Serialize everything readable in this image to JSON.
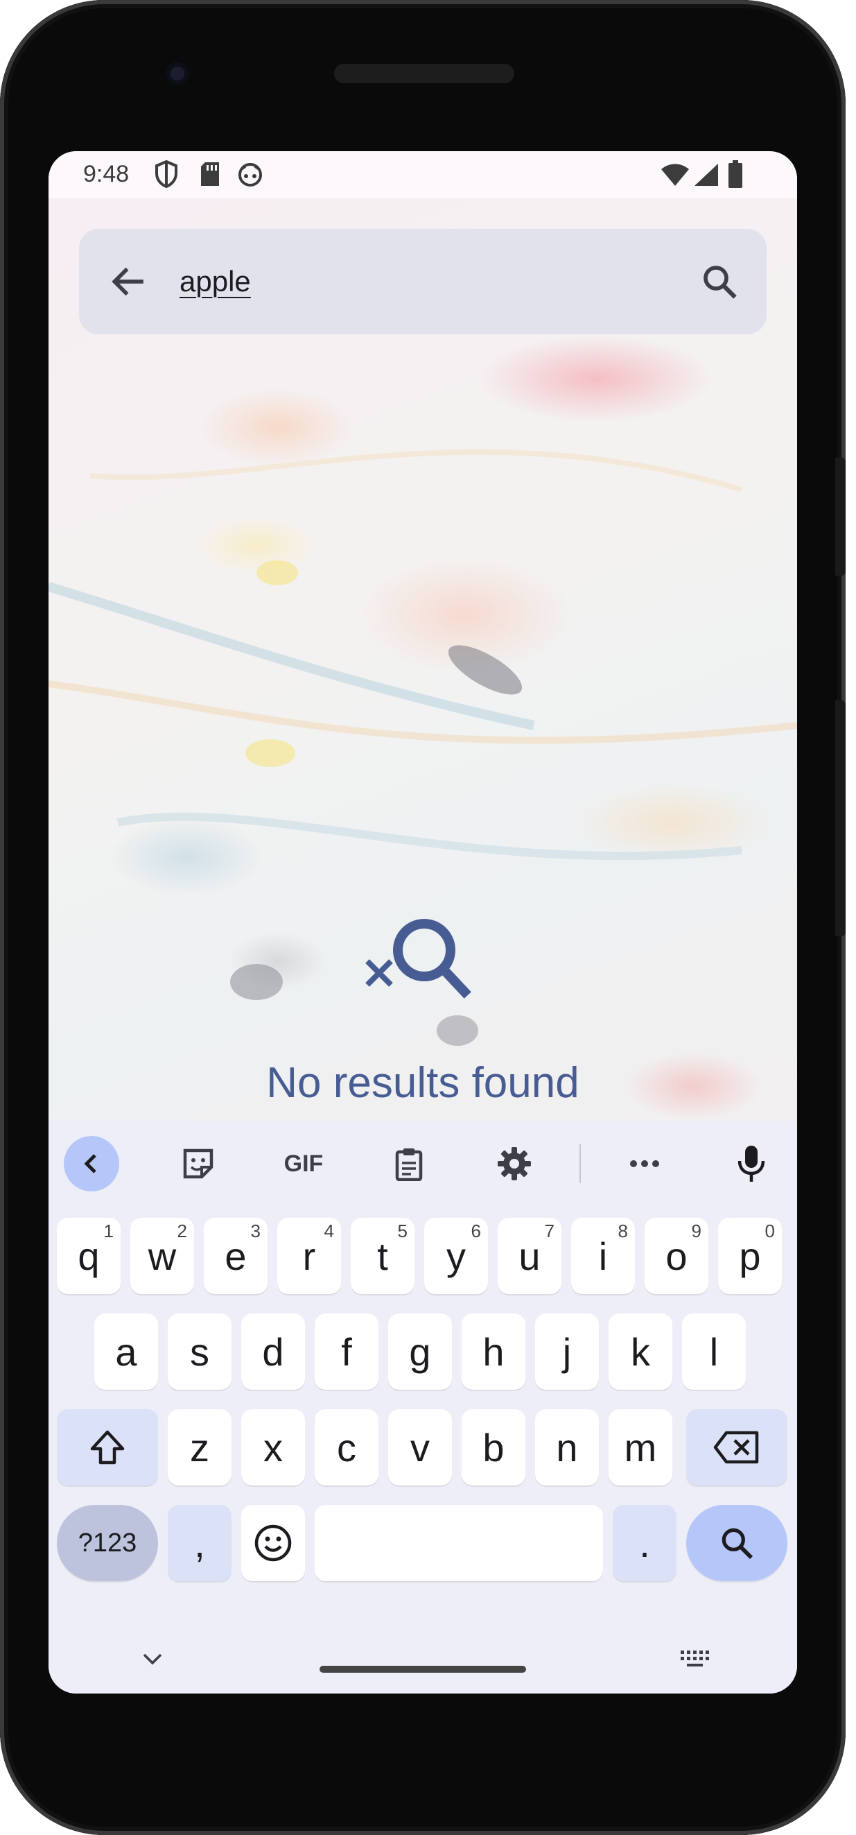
{
  "status_bar": {
    "time": "9:48",
    "left_icons": [
      "shield-icon",
      "sd-card-icon",
      "android-face-icon"
    ],
    "right_icons": [
      "wifi-icon",
      "cell-signal-icon",
      "battery-icon"
    ]
  },
  "search": {
    "query": "apple",
    "back_icon": "arrow-back-icon",
    "submit_icon": "search-icon"
  },
  "empty_state": {
    "icon": "search-off-icon",
    "message": "No results found",
    "color": "#475c93"
  },
  "keyboard": {
    "toolbar": [
      "chevron-left-icon",
      "sticker-icon",
      "GIF",
      "clipboard-icon",
      "settings-icon",
      "more-horiz-icon",
      "mic-icon"
    ],
    "gif_label": "GIF",
    "row1": [
      {
        "label": "q",
        "hint": "1"
      },
      {
        "label": "w",
        "hint": "2"
      },
      {
        "label": "e",
        "hint": "3"
      },
      {
        "label": "r",
        "hint": "4"
      },
      {
        "label": "t",
        "hint": "5"
      },
      {
        "label": "y",
        "hint": "6"
      },
      {
        "label": "u",
        "hint": "7"
      },
      {
        "label": "i",
        "hint": "8"
      },
      {
        "label": "o",
        "hint": "9"
      },
      {
        "label": "p",
        "hint": "0"
      }
    ],
    "row2": [
      "a",
      "s",
      "d",
      "f",
      "g",
      "h",
      "j",
      "k",
      "l"
    ],
    "row3": [
      "z",
      "x",
      "c",
      "v",
      "b",
      "n",
      "m"
    ],
    "symbols_label": "?123",
    "comma_label": ",",
    "period_label": ".",
    "accent_color": "#b5c7f8"
  }
}
